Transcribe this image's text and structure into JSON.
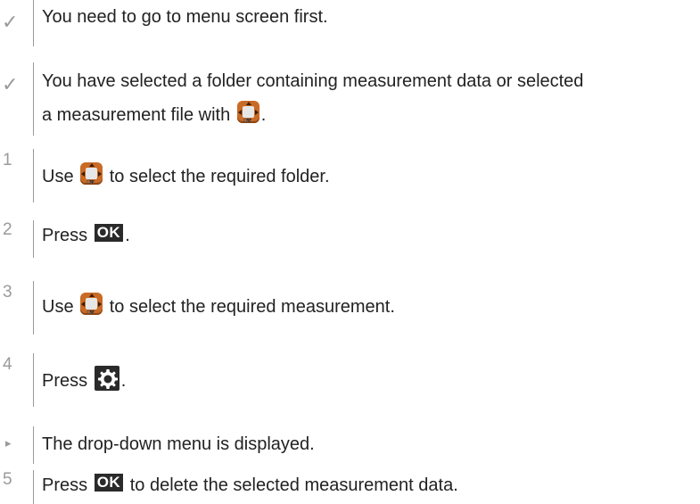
{
  "steps": [
    {
      "marker": "✓",
      "text": "You need to go to menu screen first."
    },
    {
      "marker": "✓",
      "line1": "You have selected a folder containing measurement data or selected",
      "line2_before": "a measurement file with",
      "line2_after": "."
    },
    {
      "marker": "1",
      "before": "Use",
      "after": "to select the required folder."
    },
    {
      "marker": "2",
      "before": "Press",
      "ok": "OK",
      "after": "."
    },
    {
      "marker": "3",
      "before": "Use",
      "after": "to select the required measurement."
    },
    {
      "marker": "4",
      "before": "Press",
      "after": "."
    },
    {
      "marker": "▸",
      "text": "The drop-down menu is displayed."
    },
    {
      "marker": "5",
      "before": "Press",
      "ok": "OK",
      "after": "to delete the selected measurement data."
    }
  ],
  "icons": {
    "pad": "navigation-pad-icon",
    "ok": "ok-key-icon",
    "gear": "settings-gear-icon"
  },
  "colors": {
    "pad_orange": "#c96a25",
    "marker_gray": "#9a9a9a",
    "ok_background": "#2a2a2a"
  }
}
